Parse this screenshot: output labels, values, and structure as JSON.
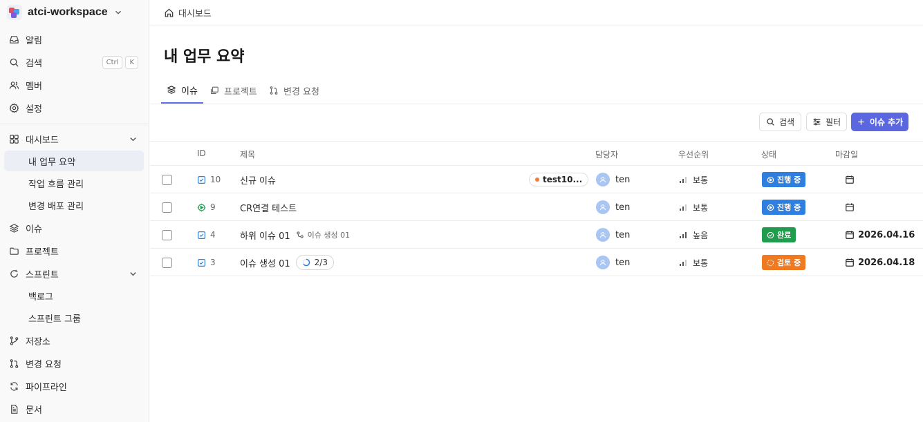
{
  "workspace": {
    "name": "atci-workspace"
  },
  "sidebar": {
    "top_items": [
      {
        "label": "알림",
        "icon": "inbox-icon"
      },
      {
        "label": "검색",
        "icon": "search-icon",
        "shortcut": [
          "Ctrl",
          "K"
        ]
      },
      {
        "label": "멤버",
        "icon": "users-icon"
      },
      {
        "label": "설정",
        "icon": "gear-icon"
      }
    ],
    "dashboard": {
      "label": "대시보드",
      "children": [
        {
          "label": "내 업무 요약",
          "active": true
        },
        {
          "label": "작업 흐름 관리"
        },
        {
          "label": "변경 배포 관리"
        }
      ]
    },
    "issues": {
      "label": "이슈"
    },
    "projects": {
      "label": "프로젝트"
    },
    "sprint": {
      "label": "스프린트",
      "children": [
        {
          "label": "백로그"
        },
        {
          "label": "스프린트 그룹"
        }
      ]
    },
    "repos": {
      "label": "저장소"
    },
    "change_requests": {
      "label": "변경 요청"
    },
    "pipelines": {
      "label": "파이프라인"
    },
    "docs": {
      "label": "문서"
    }
  },
  "breadcrumb": {
    "label": "대시보드"
  },
  "page": {
    "title": "내 업무 요약"
  },
  "tabs": [
    {
      "label": "이슈",
      "active": true
    },
    {
      "label": "프로젝트"
    },
    {
      "label": "변경 요청"
    }
  ],
  "toolbar": {
    "search_label": "검색",
    "filter_label": "필터",
    "add_label": "이슈 추가"
  },
  "table": {
    "columns": {
      "id": "ID",
      "title": "제목",
      "assignee": "담당자",
      "priority": "우선순위",
      "status": "상태",
      "due": "마감일"
    },
    "rows": [
      {
        "id": "10",
        "type": "task",
        "title": "신규 이슈",
        "label": "test10...",
        "assignee": "ten",
        "priority": "보통",
        "status": "진행 중",
        "status_color": "#2f7fe0",
        "due": ""
      },
      {
        "id": "9",
        "type": "cr",
        "title": "CR연결 테스트",
        "assignee": "ten",
        "priority": "보통",
        "status": "진행 중",
        "status_color": "#2f7fe0",
        "due": ""
      },
      {
        "id": "4",
        "type": "task",
        "title": "하위 이슈 01",
        "parent": "이슈 생성 01",
        "assignee": "ten",
        "priority": "높음",
        "status": "완료",
        "status_color": "#1f9d4c",
        "due": "2026.04.16"
      },
      {
        "id": "3",
        "type": "task",
        "title": "이슈 생성 01",
        "progress": "2/3",
        "assignee": "ten",
        "priority": "보통",
        "status": "검토 중",
        "status_color": "#ef7a22",
        "due": "2026.04.18"
      }
    ]
  },
  "colors": {
    "accent": "#5b67e0",
    "in_progress": "#2f7fe0",
    "done": "#1f9d4c",
    "review": "#ef7a22"
  }
}
